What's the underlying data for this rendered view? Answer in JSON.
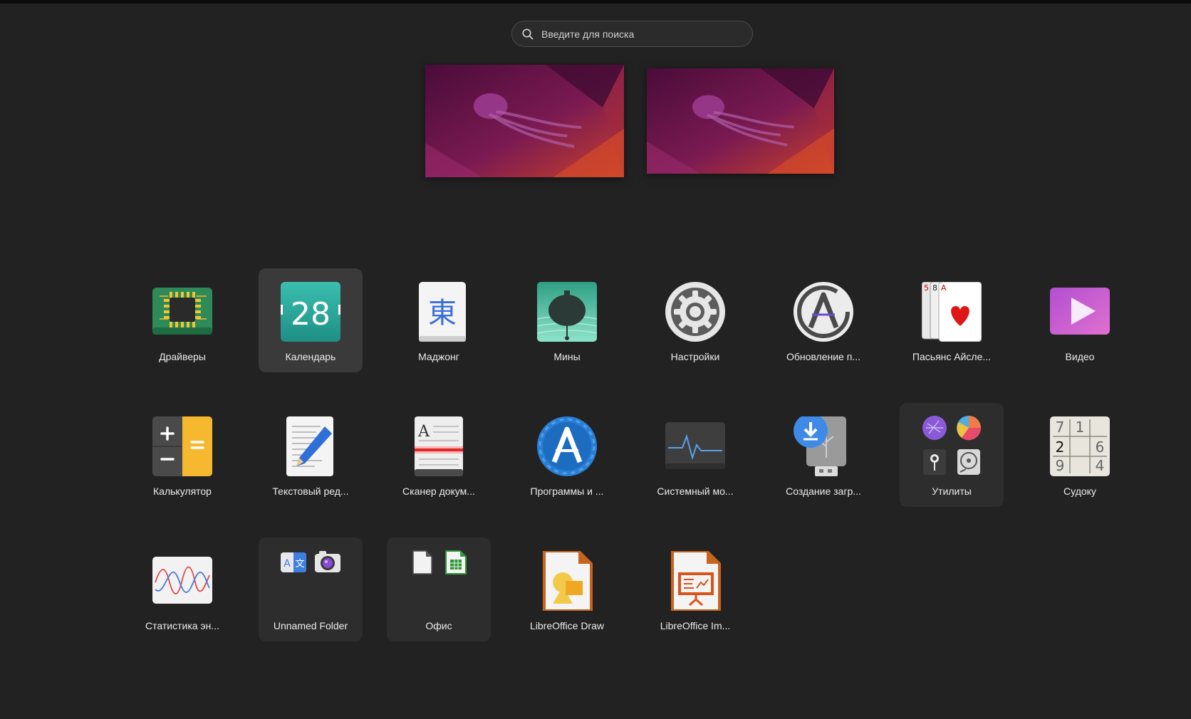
{
  "search": {
    "placeholder": "Введите для поиска"
  },
  "apps": [
    {
      "label": "Драйверы",
      "icon": "chip-icon"
    },
    {
      "label": "Календарь",
      "icon": "calendar-icon",
      "day": "28",
      "selected": true
    },
    {
      "label": "Маджонг",
      "icon": "mahjong-tile-icon",
      "glyph": "東"
    },
    {
      "label": "Мины",
      "icon": "mine-icon"
    },
    {
      "label": "Настройки",
      "icon": "gear-icon"
    },
    {
      "label": "Обновление п...",
      "icon": "software-update-icon"
    },
    {
      "label": "Пасьянс Айсле...",
      "icon": "playing-cards-icon",
      "cards": [
        "5",
        "8",
        "A"
      ]
    },
    {
      "label": "Видео",
      "icon": "video-play-icon"
    },
    {
      "label": "Калькулятор",
      "icon": "calculator-icon"
    },
    {
      "label": "Текстовый ред...",
      "icon": "text-editor-icon"
    },
    {
      "label": "Сканер докум...",
      "icon": "scanner-icon",
      "glyph": "A"
    },
    {
      "label": "Программы и ...",
      "icon": "software-store-icon"
    },
    {
      "label": "Системный мо...",
      "icon": "system-monitor-icon"
    },
    {
      "label": "Создание загр...",
      "icon": "usb-download-icon"
    },
    {
      "label": "Утилиты",
      "icon": "folder-utilities-icon",
      "folder": true
    },
    {
      "label": "Судоку",
      "icon": "sudoku-icon",
      "digits": [
        "7",
        "1",
        "2",
        "6",
        "9",
        "4"
      ]
    },
    {
      "label": "Статистика эн...",
      "icon": "power-statistics-icon"
    },
    {
      "label": "Unnamed Folder",
      "icon": "folder-unnamed-icon",
      "folder": true,
      "glyphs": [
        "A",
        "文"
      ]
    },
    {
      "label": "Офис",
      "icon": "folder-office-icon",
      "folder": true
    },
    {
      "label": "LibreOffice Draw",
      "icon": "libreoffice-draw-icon"
    },
    {
      "label": "LibreOffice Im...",
      "icon": "libreoffice-impress-icon"
    }
  ],
  "workspaces": [
    {
      "name": "workspace-1"
    },
    {
      "name": "workspace-2"
    }
  ],
  "colors": {
    "background": "#222222",
    "selected_tile": "#3a3a3a",
    "folder_tile": "#2d2d2d",
    "accent": "#e95420"
  }
}
